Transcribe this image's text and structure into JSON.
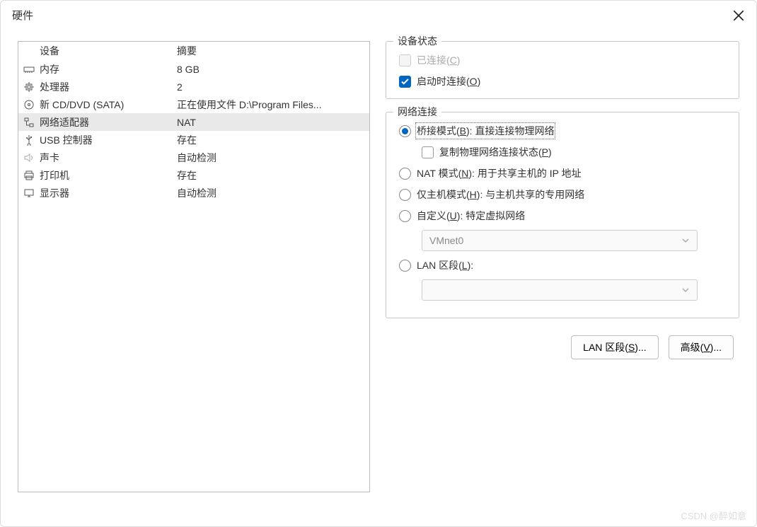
{
  "window": {
    "title": "硬件"
  },
  "table": {
    "headers": {
      "device": "设备",
      "summary": "摘要"
    },
    "rows": [
      {
        "icon": "memory-icon",
        "name": "内存",
        "summary": "8 GB",
        "selected": false
      },
      {
        "icon": "cpu-icon",
        "name": "处理器",
        "summary": "2",
        "selected": false
      },
      {
        "icon": "disc-icon",
        "name": "新 CD/DVD (SATA)",
        "summary": "正在使用文件 D:\\Program Files...",
        "selected": false
      },
      {
        "icon": "network-icon",
        "name": "网络适配器",
        "summary": "NAT",
        "selected": true
      },
      {
        "icon": "usb-icon",
        "name": "USB 控制器",
        "summary": "存在",
        "selected": false
      },
      {
        "icon": "sound-icon",
        "name": "声卡",
        "summary": "自动检测",
        "selected": false
      },
      {
        "icon": "printer-icon",
        "name": "打印机",
        "summary": "存在",
        "selected": false
      },
      {
        "icon": "display-icon",
        "name": "显示器",
        "summary": "自动检测",
        "selected": false
      }
    ]
  },
  "deviceStatus": {
    "title": "设备状态",
    "connected": {
      "pre": "已连接(",
      "key": "C",
      "post": ")",
      "checked": false,
      "disabled": true
    },
    "connectOnPower": {
      "pre": "启动时连接(",
      "key": "O",
      "post": ")",
      "checked": true
    }
  },
  "networkConn": {
    "title": "网络连接",
    "bridged": {
      "pre": "桥接模式(",
      "key": "B",
      "post": "): 直接连接物理网络",
      "checked": true
    },
    "replicate": {
      "pre": "复制物理网络连接状态(",
      "key": "P",
      "post": ")",
      "checked": false
    },
    "nat": {
      "pre": "NAT 模式(",
      "key": "N",
      "post": "): 用于共享主机的 IP 地址",
      "checked": false
    },
    "host": {
      "pre": "仅主机模式(",
      "key": "H",
      "post": "): 与主机共享的专用网络",
      "checked": false
    },
    "custom": {
      "pre": "自定义(",
      "key": "U",
      "post": "): 特定虚拟网络",
      "checked": false
    },
    "customSelect": "VMnet0",
    "lan": {
      "pre": "LAN 区段(",
      "key": "L",
      "post": "):",
      "checked": false
    },
    "lanSelectPlaceholder": ""
  },
  "buttons": {
    "lanSegments": {
      "pre": "LAN 区段(",
      "key": "S",
      "post": ")..."
    },
    "advanced": {
      "pre": "高级(",
      "key": "V",
      "post": ")..."
    }
  },
  "watermark": "CSDN @醉如意"
}
